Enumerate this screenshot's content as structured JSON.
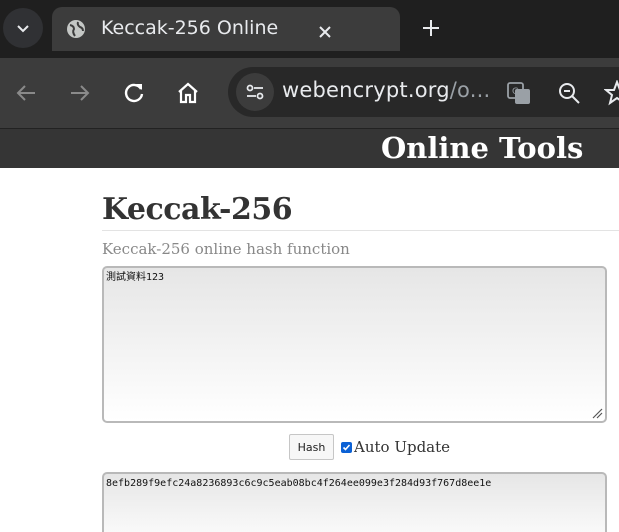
{
  "browser": {
    "tab": {
      "title": "Keccak-256 Online",
      "favicon": "globe-icon"
    },
    "url": {
      "domain": "webencrypt.org",
      "path": "/o..."
    },
    "icons": [
      "tab-search-icon",
      "close-icon",
      "new-tab-plus-icon",
      "back-arrow-icon",
      "forward-arrow-icon",
      "reload-icon",
      "home-icon",
      "site-settings-icon",
      "translate-icon",
      "zoom-icon",
      "bookmark-star-icon"
    ]
  },
  "site": {
    "header_title": "Online Tools"
  },
  "page": {
    "heading": "Keccak-256",
    "subtitle": "Keccak-256 online hash function",
    "input_value": "測試資料123",
    "hash_button": "Hash",
    "auto_update_label": "Auto Update",
    "auto_update_checked": true,
    "output_value": "8efb289f9efc24a8236893c6c9c5eab08bc4f264ee099e3f284d93f767d8ee1e"
  },
  "colors": {
    "checkbox_accent": "#0b61d5",
    "header_bg": "#353535"
  }
}
